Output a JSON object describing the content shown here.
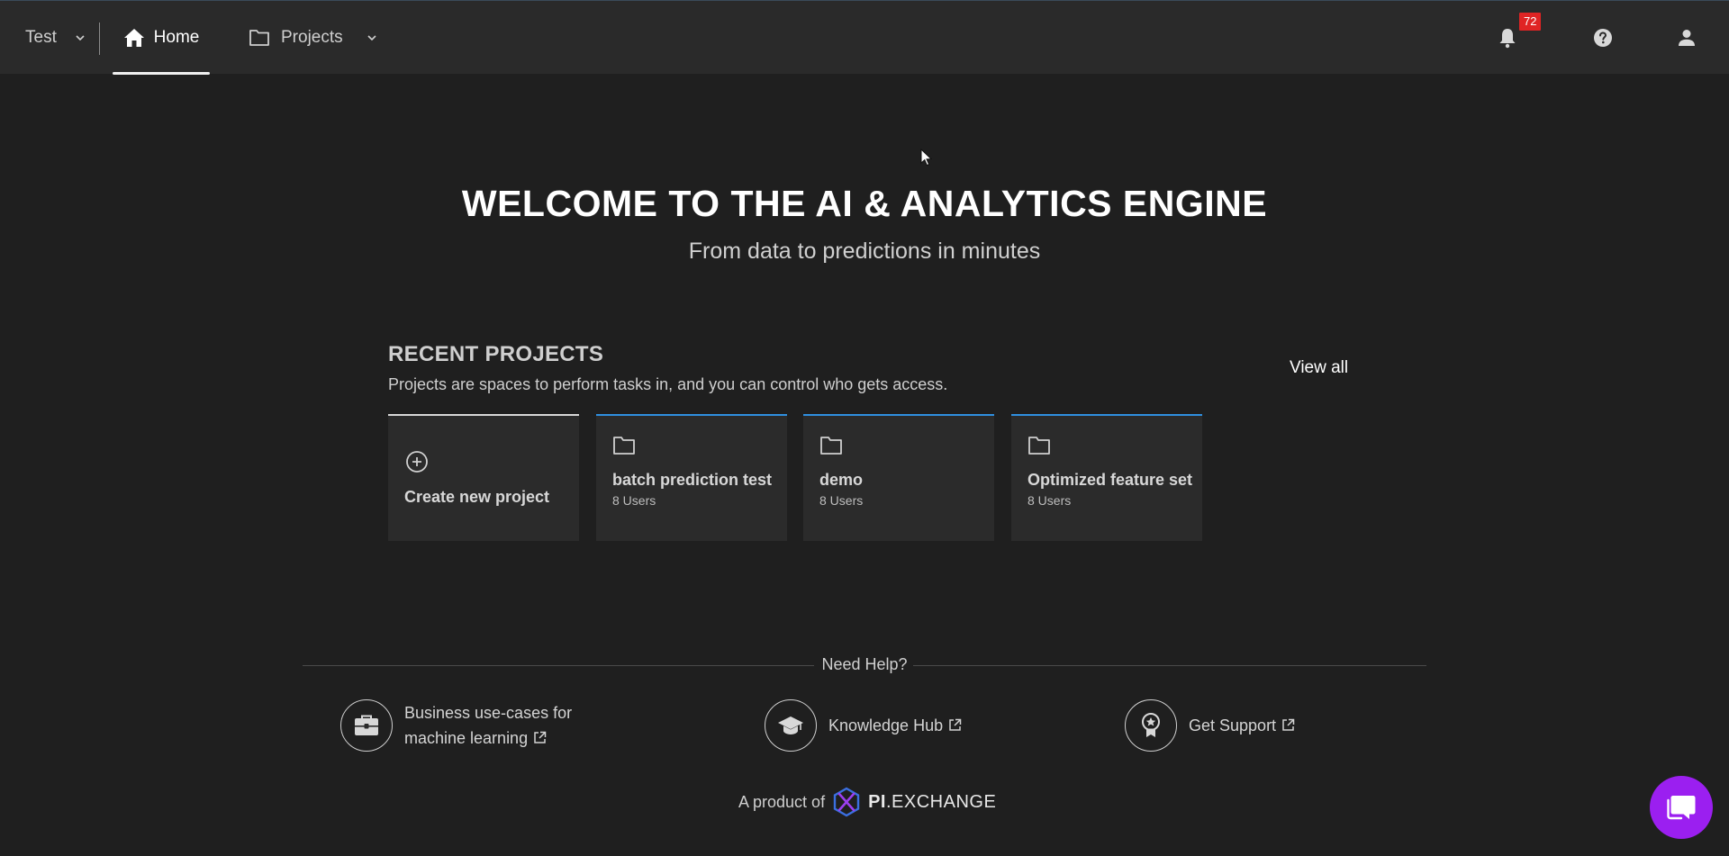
{
  "nav": {
    "workspace": "Test",
    "home": "Home",
    "projects": "Projects",
    "notifications_count": "72"
  },
  "hero": {
    "title": "WELCOME TO THE AI & ANALYTICS ENGINE",
    "subtitle": "From data to predictions in minutes"
  },
  "recent": {
    "title": "RECENT PROJECTS",
    "description": "Projects are spaces to perform tasks in, and you can control who gets access.",
    "view_all": "View all",
    "create_label": "Create new project",
    "projects": [
      {
        "name": "batch prediction test",
        "users": "8 Users"
      },
      {
        "name": "demo",
        "users": "8 Users"
      },
      {
        "name": "Optimized feature set",
        "users": "8 Users"
      }
    ]
  },
  "help": {
    "title": "Need Help?",
    "business_line1": "Business use-cases for",
    "business_line2": "machine learning",
    "knowledge": "Knowledge Hub",
    "support": "Get Support"
  },
  "footer": {
    "product_of": "A product of",
    "brand_bold": "PI",
    "brand_rest": ".EXCHANGE"
  },
  "colors": {
    "background": "#1f1f1f",
    "topbar": "#2a2a2a",
    "card": "#2b2b2b",
    "card_accent": "#2f8fe0",
    "badge": "#e02424",
    "chat": "#9b1ff0"
  }
}
